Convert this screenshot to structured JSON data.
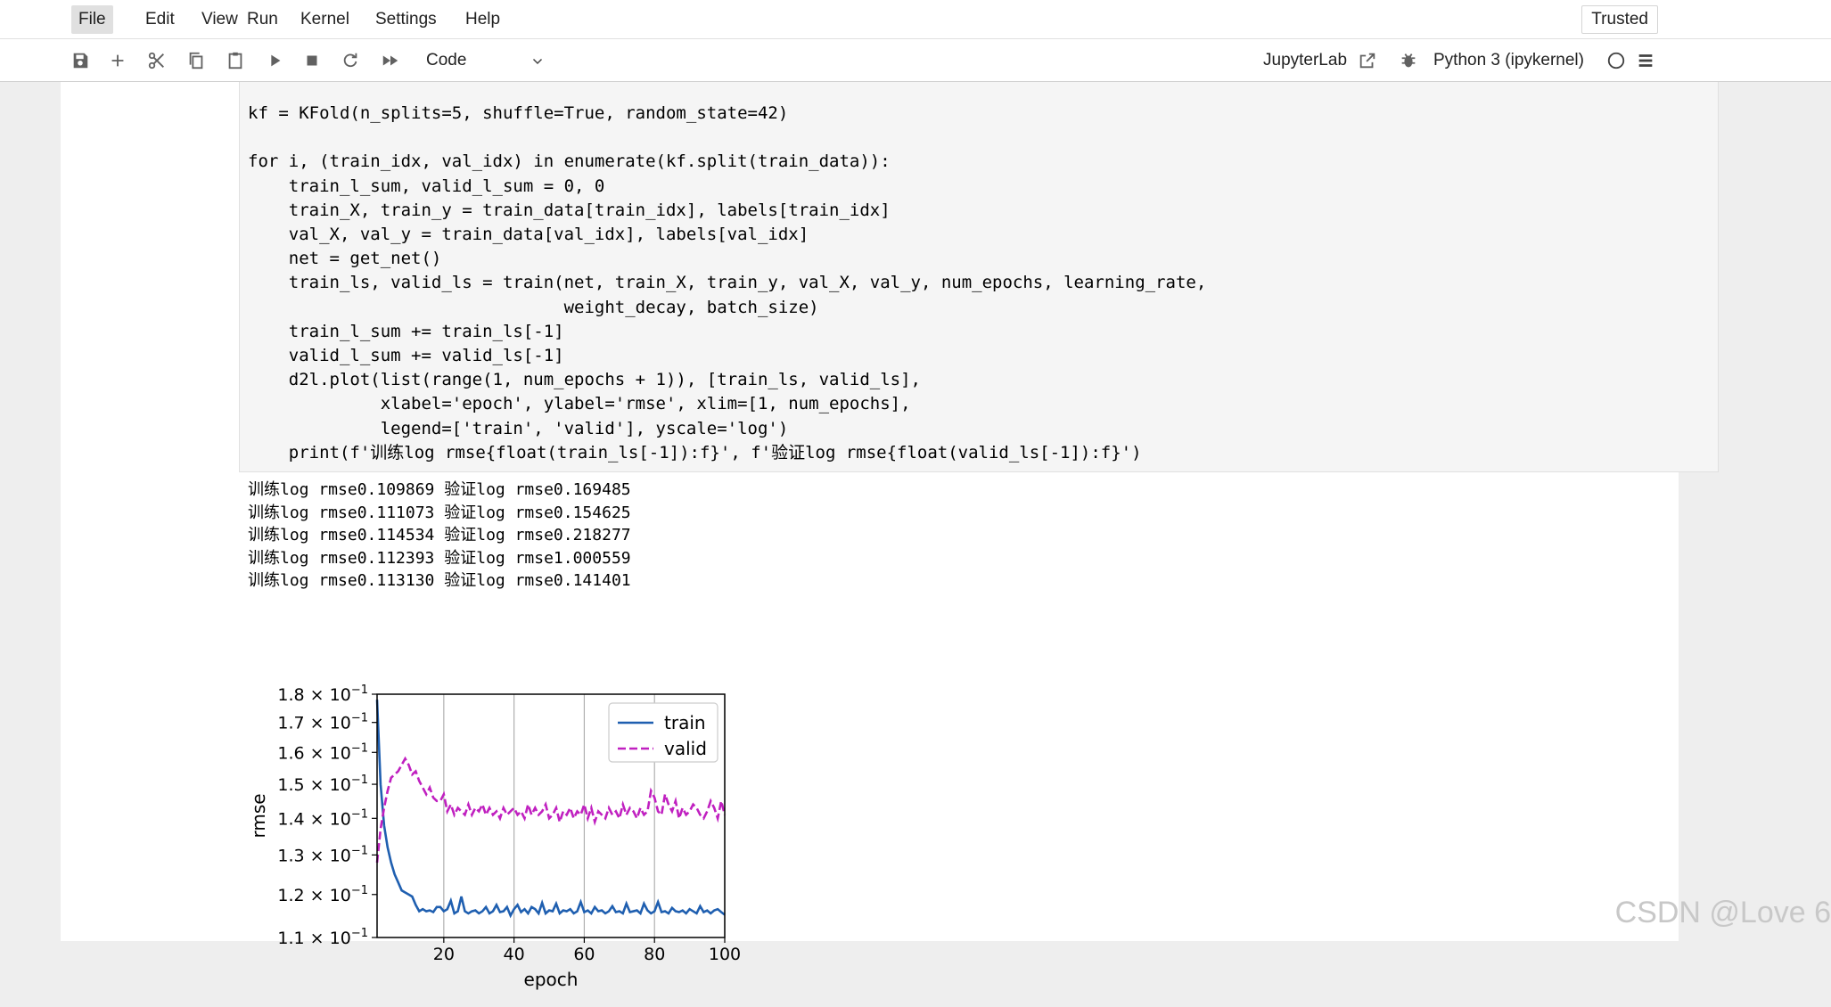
{
  "menubar": {
    "items": [
      "File",
      "Edit",
      "View",
      "Run",
      "Kernel",
      "Settings",
      "Help"
    ],
    "trusted_label": "Trusted"
  },
  "toolbar": {
    "buttons": [
      "save-icon",
      "add-icon",
      "cut-icon",
      "copy-icon",
      "paste-icon",
      "run-icon",
      "stop-icon",
      "restart-icon",
      "fast-forward-icon"
    ],
    "cell_type": "Code",
    "jupyterlab_label": "JupyterLab",
    "kernel_label": "Python 3 (ipykernel)"
  },
  "code_cell": {
    "lines": [
      "kf = KFold(n_splits=5, shuffle=True, random_state=42)",
      "",
      "for i, (train_idx, val_idx) in enumerate(kf.split(train_data)):",
      "    train_l_sum, valid_l_sum = 0, 0",
      "    train_X, train_y = train_data[train_idx], labels[train_idx]",
      "    val_X, val_y = train_data[val_idx], labels[val_idx]",
      "    net = get_net()",
      "    train_ls, valid_ls = train(net, train_X, train_y, val_X, val_y, num_epochs, learning_rate,",
      "                               weight_decay, batch_size)",
      "    train_l_sum += train_ls[-1]",
      "    valid_l_sum += valid_ls[-1]",
      "    d2l.plot(list(range(1, num_epochs + 1)), [train_ls, valid_ls],",
      "             xlabel='epoch', ylabel='rmse', xlim=[1, num_epochs],",
      "             legend=['train', 'valid'], yscale='log')",
      "    print(f'训练log rmse{float(train_ls[-1]):f}', f'验证log rmse{float(valid_ls[-1]):f}')"
    ]
  },
  "output": {
    "lines": [
      "训练log rmse0.109869 验证log rmse0.169485",
      "训练log rmse0.111073 验证log rmse0.154625",
      "训练log rmse0.114534 验证log rmse0.218277",
      "训练log rmse0.112393 验证log rmse1.000559",
      "训练log rmse0.113130 验证log rmse0.141401"
    ]
  },
  "chart_data": {
    "type": "line",
    "xlabel": "epoch",
    "ylabel": "rmse",
    "xlim": [
      1,
      100
    ],
    "ylim": [
      0.11,
      0.18
    ],
    "yscale": "log",
    "grid": "vertical",
    "legend_position": "top-right",
    "x_ticks": [
      "20",
      "40",
      "60",
      "80",
      "100"
    ],
    "y_ticks": [
      {
        "value": 0.18,
        "mantissa": "1.8"
      },
      {
        "value": 0.17,
        "mantissa": "1.7"
      },
      {
        "value": 0.16,
        "mantissa": "1.6"
      },
      {
        "value": 0.15,
        "mantissa": "1.5"
      },
      {
        "value": 0.14,
        "mantissa": "1.4"
      },
      {
        "value": 0.13,
        "mantissa": "1.3"
      },
      {
        "value": 0.12,
        "mantissa": "1.2"
      },
      {
        "value": 0.11,
        "mantissa": "1.1"
      }
    ],
    "y_tick_suffix": " × 10",
    "y_tick_exp": "−1",
    "series": [
      {
        "name": "train",
        "color": "#1f5fb0",
        "style": "solid",
        "values": [
          0.178,
          0.15,
          0.138,
          0.132,
          0.128,
          0.125,
          0.123,
          0.121,
          0.1205,
          0.12,
          0.1195,
          0.1175,
          0.116,
          0.1165,
          0.116,
          0.1162,
          0.1158,
          0.117,
          0.117,
          0.116,
          0.1165,
          0.1185,
          0.1155,
          0.116,
          0.1195,
          0.116,
          0.1155,
          0.116,
          0.1162,
          0.1155,
          0.116,
          0.117,
          0.1155,
          0.116,
          0.1175,
          0.1158,
          0.116,
          0.117,
          0.115,
          0.1165,
          0.1175,
          0.1158,
          0.1165,
          0.1155,
          0.117,
          0.1165,
          0.1155,
          0.118,
          0.1155,
          0.1162,
          0.116,
          0.1178,
          0.1155,
          0.1162,
          0.116,
          0.1165,
          0.1155,
          0.116,
          0.1182,
          0.1158,
          0.1162,
          0.1155,
          0.117,
          0.116,
          0.1162,
          0.1155,
          0.116,
          0.1172,
          0.1158,
          0.116,
          0.1155,
          0.1178,
          0.1158,
          0.116,
          0.1162,
          0.1155,
          0.1178,
          0.1162,
          0.1155,
          0.116,
          0.1182,
          0.1158,
          0.116,
          0.1155,
          0.1168,
          0.116,
          0.1158,
          0.1162,
          0.1155,
          0.1165,
          0.116,
          0.1155,
          0.1172,
          0.1158,
          0.1162,
          0.1155,
          0.1162,
          0.1165,
          0.1158,
          0.1152
        ]
      },
      {
        "name": "valid",
        "color": "#c020c0",
        "style": "dashed",
        "values": [
          0.128,
          0.137,
          0.143,
          0.148,
          0.152,
          0.153,
          0.154,
          0.156,
          0.158,
          0.156,
          0.153,
          0.154,
          0.151,
          0.149,
          0.147,
          0.149,
          0.146,
          0.145,
          0.145,
          0.147,
          0.142,
          0.144,
          0.141,
          0.143,
          0.142,
          0.141,
          0.144,
          0.141,
          0.143,
          0.142,
          0.144,
          0.141,
          0.143,
          0.141,
          0.142,
          0.14,
          0.143,
          0.141,
          0.142,
          0.143,
          0.141,
          0.142,
          0.14,
          0.144,
          0.141,
          0.143,
          0.141,
          0.142,
          0.144,
          0.14,
          0.141,
          0.143,
          0.139,
          0.142,
          0.141,
          0.143,
          0.14,
          0.142,
          0.141,
          0.144,
          0.14,
          0.143,
          0.139,
          0.142,
          0.141,
          0.14,
          0.143,
          0.141,
          0.142,
          0.14,
          0.144,
          0.141,
          0.143,
          0.142,
          0.14,
          0.143,
          0.141,
          0.142,
          0.148,
          0.146,
          0.142,
          0.141,
          0.147,
          0.144,
          0.142,
          0.145,
          0.14,
          0.143,
          0.141,
          0.142,
          0.144,
          0.143,
          0.141,
          0.14,
          0.142,
          0.145,
          0.143,
          0.14,
          0.145,
          0.141
        ]
      }
    ]
  },
  "watermark": "CSDN @Love 6"
}
